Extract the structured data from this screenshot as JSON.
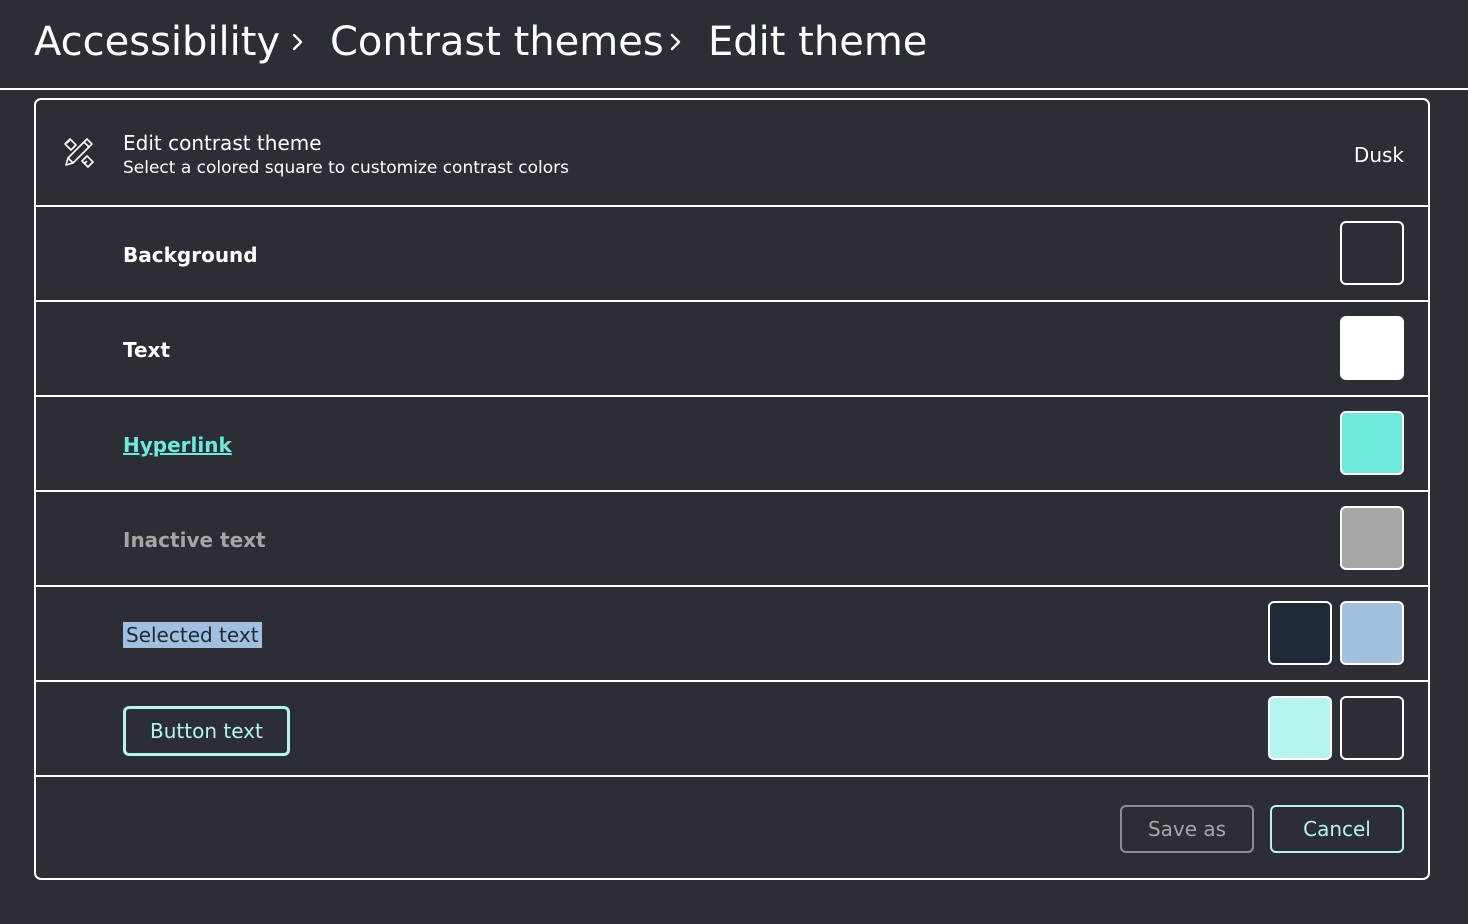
{
  "breadcrumb": {
    "items": [
      "Accessibility",
      "Contrast themes",
      "Edit theme"
    ],
    "separator_icon": "chevron-right-icon"
  },
  "theme_header": {
    "icon": "pencil-ruler-icon",
    "title": "Edit contrast theme",
    "subtitle": "Select a colored square to customize contrast colors",
    "theme_name": "Dusk"
  },
  "colors": {
    "background": "#2b2f35",
    "text": "#ffffff",
    "hyperlink": "#6ee9dc",
    "inactive_text": "#a6a6a6",
    "selected_text_foreground": "#1f2a38",
    "selected_text_background": "#a1bfde",
    "button_text_foreground": "#b6f4ee",
    "button_text_background": "#2b2f35"
  },
  "rows": {
    "background": {
      "label": "Background"
    },
    "text": {
      "label": "Text"
    },
    "hyperlink": {
      "label": "Hyperlink"
    },
    "inactive": {
      "label": "Inactive text"
    },
    "selected": {
      "label": "Selected text"
    },
    "button": {
      "label": "Button text"
    }
  },
  "actions": {
    "save_as": "Save as",
    "cancel": "Cancel"
  }
}
